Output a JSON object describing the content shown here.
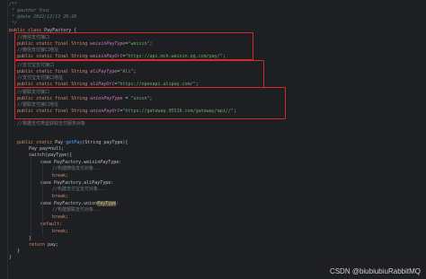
{
  "header": {
    "comment_open": "/**",
    "author_tag": " * @author",
    "author_value": " Ynui",
    "date_tag": " * @date",
    "date_value": " 2022/12/13 20:28",
    "comment_close": " */"
  },
  "class_decl": {
    "modifiers": "public class ",
    "name": "PayFactory",
    "brace": " {"
  },
  "sections": [
    {
      "comment_title": "//微信支付接口",
      "field1": {
        "decl": "public static final String ",
        "name": "weixinPayType",
        "assign": "=",
        "value": "\"weixin\"",
        "end": ";"
      },
      "comment_url": "//微信支付接口地址",
      "field2": {
        "decl": "public static final String ",
        "name": "weixinPayUrl",
        "assign": "=",
        "value": "\"https://api.mch.weixin.qq.com/pay/\"",
        "end": ";"
      }
    },
    {
      "comment_title": "//支付宝支付接口",
      "field1": {
        "decl": "public static final String ",
        "name": "aliPayType",
        "assign": "=",
        "value": "\"Ali\"",
        "end": ";"
      },
      "comment_url": "//支付宝支付接口地址",
      "field2": {
        "decl": "public static final String ",
        "name": "aliPayUrl",
        "assign": "=",
        "value": "\"https://openapi.alipay.com/\"",
        "end": ";"
      }
    },
    {
      "comment_title": "//银联支付接口",
      "field1": {
        "decl": "public static final String ",
        "name": "unionPayType",
        "assign": " = ",
        "value": "\"union\"",
        "end": ";"
      },
      "comment_url": "//银联支付接口地址",
      "field2": {
        "decl": "public static final String ",
        "name": "unionPayUrl",
        "assign": "=",
        "value": "\"https://gateway.95516.com/gateway/api//\"",
        "end": ";"
      }
    }
  ],
  "after_comment": "//根据支付类型获取支付服务对象",
  "method": {
    "sig_mod": "public static ",
    "sig_type": "Pay ",
    "sig_name": "getPay",
    "sig_params": "(String payType){",
    "var_line": "Pay pay=null;",
    "switch_line": "switch(payType){",
    "case1": "case PayFactory.weixinPayType:",
    "case1_comment": "//构建微信支付对象...",
    "break": "break;",
    "case2": "case PayFactory.aliPayType:",
    "case2_comment": "//构建支付宝支付对象...",
    "case3_prefix": "case PayFactory.unionPayType",
    "case3_colon": ":",
    "case3_highlight": "PayType",
    "case3_comment": "//构建银联支付对象...",
    "default": "default:",
    "switch_close": "}",
    "return_kw": "return ",
    "return_var": "pay",
    "return_end": ";",
    "method_close": "}"
  },
  "class_close": "}",
  "watermark": "CSDN @biubiubiuRabbitMQ"
}
